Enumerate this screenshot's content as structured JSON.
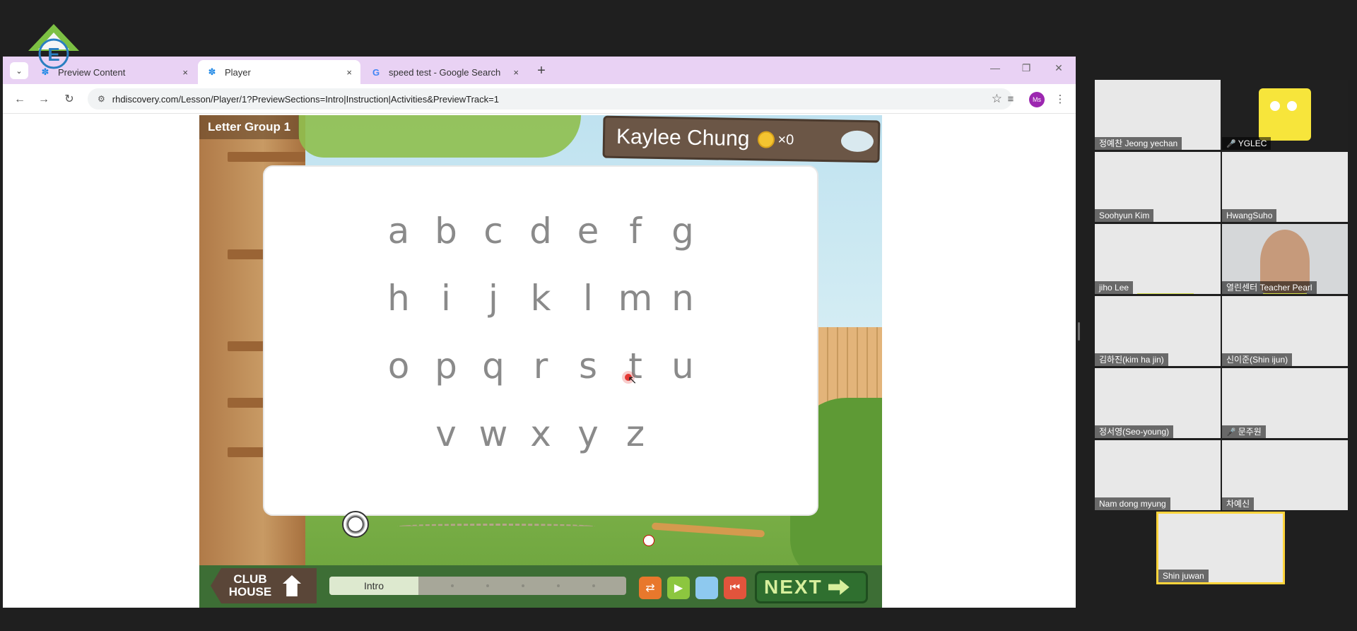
{
  "browser": {
    "tabs": [
      {
        "title": "Preview Content",
        "close": "×",
        "icon": "butterfly-icon"
      },
      {
        "title": "Player",
        "close": "×",
        "icon": "butterfly-icon"
      },
      {
        "title": "speed test - Google Search",
        "close": "×",
        "icon": "google-icon"
      }
    ],
    "new_tab": "+",
    "url": "rhdiscovery.com/Lesson/Player/1?PreviewSections=Intro|Instruction|Activities&PreviewTrack=1",
    "profile_initials": "Ms"
  },
  "game": {
    "letter_group": "Letter Group 1",
    "player_name": "Kaylee Chung",
    "coin_count": "×0",
    "letters": [
      [
        "a",
        "b",
        "c",
        "d",
        "e",
        "f",
        "g"
      ],
      [
        "h",
        "i",
        "j",
        "k",
        "l",
        "m",
        "n"
      ],
      [
        "o",
        "p",
        "q",
        "r",
        "s",
        "t",
        "u"
      ],
      [
        "v",
        "w",
        "x",
        "y",
        "z"
      ]
    ],
    "clubhouse": "CLUB HOUSE",
    "progress_label": "Intro",
    "progress_fraction": 0.3,
    "next": "NEXT",
    "colors": {
      "shuffle": "#e8782c",
      "play": "#8cc63f",
      "blank": "#8ec9ef",
      "rewind": "#e2543c"
    }
  },
  "participants": [
    {
      "name": "정예찬 Jeong yechan",
      "muted": false
    },
    {
      "name": "YGLEC",
      "muted": true
    },
    {
      "name": "Soohyun Kim",
      "muted": false
    },
    {
      "name": "HwangSuho",
      "muted": false
    },
    {
      "name": "jiho Lee",
      "muted": false
    },
    {
      "name": "열린센터 Teacher Pearl",
      "muted": false
    },
    {
      "name": "김하진(kim ha jin)",
      "muted": false
    },
    {
      "name": "신이준(Shin ijun)",
      "muted": false
    },
    {
      "name": "정서영(Seo-young)",
      "muted": false
    },
    {
      "name": "문주원",
      "muted": true
    },
    {
      "name": "Nam dong myung",
      "muted": false
    },
    {
      "name": "차예신",
      "muted": false
    },
    {
      "name": "Shin juwan",
      "muted": false
    }
  ]
}
